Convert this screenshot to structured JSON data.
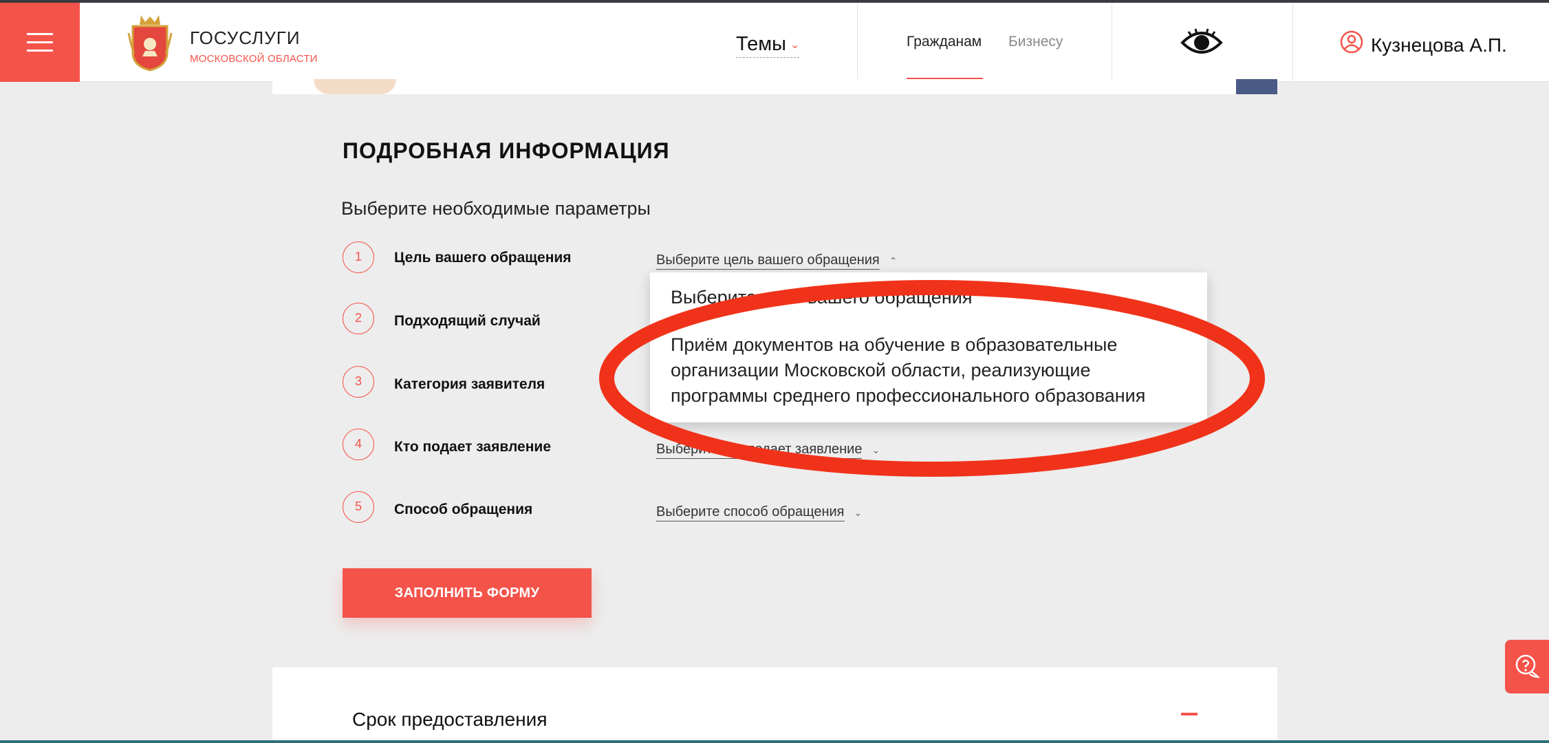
{
  "header": {
    "brand_title": "ГОСУСЛУГИ",
    "brand_subtitle": "МОСКОВСКОЙ ОБЛАСТИ",
    "themes_label": "Темы",
    "nav": [
      {
        "label": "Гражданам",
        "active": true
      },
      {
        "label": "Бизнесу",
        "active": false
      }
    ],
    "user_name": "Кузнецова А.П."
  },
  "main": {
    "section_title": "ПОДРОБНАЯ ИНФОРМАЦИЯ",
    "subtitle": "Выберите необходимые параметры",
    "steps": [
      {
        "number": "1",
        "label": "Цель вашего обращения",
        "select": "Выберите цель вашего обращения",
        "expanded": true
      },
      {
        "number": "2",
        "label": "Подходящий случай",
        "select": ""
      },
      {
        "number": "3",
        "label": "Категория заявителя",
        "select": ""
      },
      {
        "number": "4",
        "label": "Кто подает заявление",
        "select": "Выберите кто подает заявление"
      },
      {
        "number": "5",
        "label": "Способ обращения",
        "select": "Выберите способ обращения"
      }
    ],
    "dropdown_options": [
      "Выберите цель вашего обращения",
      "Приём документов на обучение в образовательные",
      "организации Московской области, реализующие",
      "программы среднего профессионального образования"
    ],
    "fill_button": "ЗАПОЛНИТЬ ФОРМУ"
  },
  "details": {
    "title": "Срок предоставления"
  },
  "colors": {
    "accent": "#f4534a",
    "annotation": "#f1321a",
    "background": "#ededed"
  },
  "icons": [
    "menu-icon",
    "moscow-region-emblem",
    "chevron-down-icon",
    "eye-icon",
    "user-icon",
    "chevron-up-icon",
    "minus-icon",
    "help-chat-icon"
  ]
}
